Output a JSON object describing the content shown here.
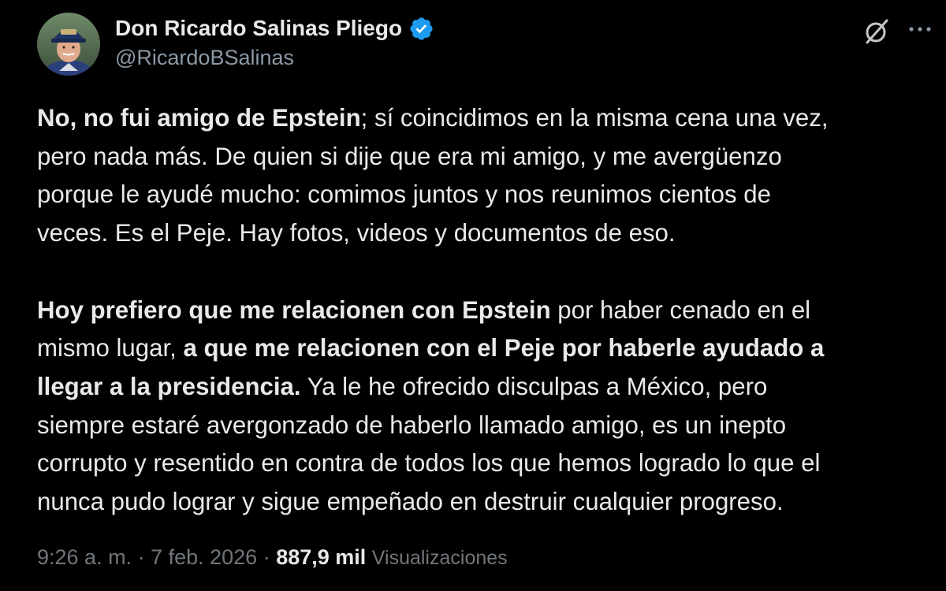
{
  "author": {
    "display_name": "Don Ricardo Salinas Pliego",
    "handle": "@RicardoBSalinas",
    "verified": true,
    "verified_color": "#1d9bf0",
    "avatar_icon": "profile-photo-man-with-cap"
  },
  "header_actions": {
    "grok_icon": "grok-icon",
    "more_icon": "more-options-icon"
  },
  "tweet": {
    "paragraph1": [
      {
        "bold": "No, no fui amigo de Epstein",
        "normal": "; sí coincidimos en la misma cena una vez,"
      },
      {
        "normal": "pero nada más. De quien si dije que era mi amigo, y me avergüenzo"
      },
      {
        "normal": "porque le ayudé mucho: comimos juntos y nos reunimos cientos de"
      },
      {
        "normal": "veces. Es el Peje. Hay fotos, videos y documentos de eso."
      }
    ],
    "paragraph2": [
      {
        "bold": "Hoy prefiero que me relacionen con Epstein",
        "normal": " por haber cenado en el"
      },
      {
        "normal": "mismo lugar, ",
        "bold": "a que me relacionen con el Peje por haberle ayudado a"
      },
      {
        "bold": "llegar a la presidencia.",
        "normal": " Ya le he ofrecido disculpas a México, pero"
      },
      {
        "normal": "siempre estaré avergonzado de haberlo llamado amigo, es un inepto"
      },
      {
        "normal": "corrupto y resentido en contra de todos los que hemos logrado lo que el"
      },
      {
        "normal": "nunca pudo lograr y sigue empeñado en destruir cualquier progreso."
      }
    ]
  },
  "meta": {
    "time": "9:26 a. m.",
    "separator": " · ",
    "date": "7 feb. 2026",
    "views_count": "887,9 mil",
    "views_label": "Visualizaciones"
  },
  "colors": {
    "background": "#000000",
    "text_primary": "#e7e9ea",
    "text_secondary": "#71767b",
    "handle": "#8b98a5"
  }
}
